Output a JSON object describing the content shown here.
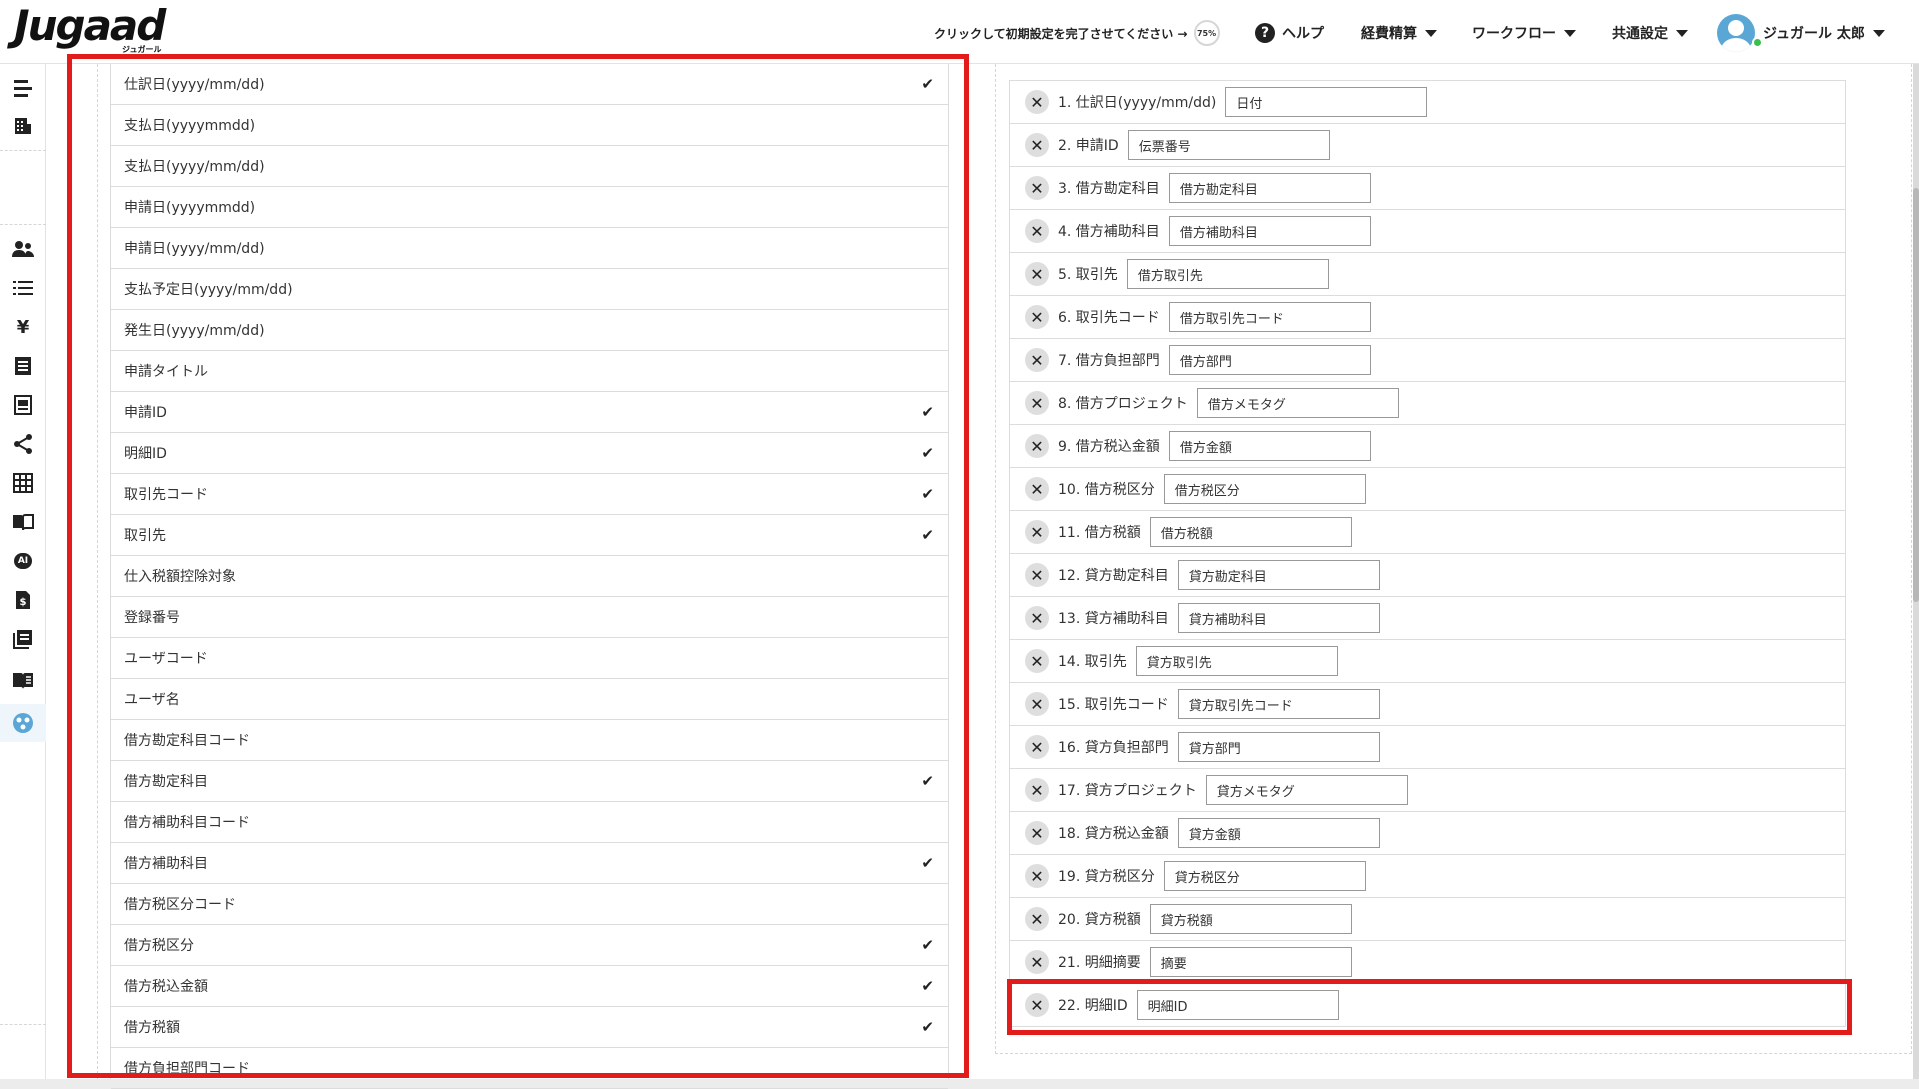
{
  "header": {
    "logo_text": "Jugaad",
    "logo_sub": "ジュガール",
    "setup_text": "クリックして初期設定を完了させてください →",
    "setup_progress": "75%",
    "help_label": "ヘルプ",
    "menus": [
      "経費精算",
      "ワークフロー",
      "共通設定"
    ],
    "user_name": "ジュガール 太郎"
  },
  "left_fields": [
    {
      "label": "仕訳日(yyyy/mm/dd)",
      "checked": true
    },
    {
      "label": "支払日(yyyymmdd)",
      "checked": false
    },
    {
      "label": "支払日(yyyy/mm/dd)",
      "checked": false
    },
    {
      "label": "申請日(yyyymmdd)",
      "checked": false
    },
    {
      "label": "申請日(yyyy/mm/dd)",
      "checked": false
    },
    {
      "label": "支払予定日(yyyy/mm/dd)",
      "checked": false
    },
    {
      "label": "発生日(yyyy/mm/dd)",
      "checked": false
    },
    {
      "label": "申請タイトル",
      "checked": false
    },
    {
      "label": "申請ID",
      "checked": true
    },
    {
      "label": "明細ID",
      "checked": true
    },
    {
      "label": "取引先コード",
      "checked": true
    },
    {
      "label": "取引先",
      "checked": true
    },
    {
      "label": "仕入税額控除対象",
      "checked": false
    },
    {
      "label": "登録番号",
      "checked": false
    },
    {
      "label": "ユーザコード",
      "checked": false
    },
    {
      "label": "ユーザ名",
      "checked": false
    },
    {
      "label": "借方勘定科目コード",
      "checked": false
    },
    {
      "label": "借方勘定科目",
      "checked": true
    },
    {
      "label": "借方補助科目コード",
      "checked": false
    },
    {
      "label": "借方補助科目",
      "checked": true
    },
    {
      "label": "借方税区分コード",
      "checked": false
    },
    {
      "label": "借方税区分",
      "checked": true
    },
    {
      "label": "借方税込金額",
      "checked": true
    },
    {
      "label": "借方税額",
      "checked": true
    },
    {
      "label": "借方負担部門コード",
      "checked": false
    }
  ],
  "check_glyph": "✔",
  "mappings": [
    {
      "label": "1. 仕訳日(yyyy/mm/dd)",
      "value": "日付"
    },
    {
      "label": "2. 申請ID",
      "value": "伝票番号"
    },
    {
      "label": "3. 借方勘定科目",
      "value": "借方勘定科目"
    },
    {
      "label": "4. 借方補助科目",
      "value": "借方補助科目"
    },
    {
      "label": "5. 取引先",
      "value": "借方取引先"
    },
    {
      "label": "6. 取引先コード",
      "value": "借方取引先コード"
    },
    {
      "label": "7. 借方負担部門",
      "value": "借方部門"
    },
    {
      "label": "8. 借方プロジェクト",
      "value": "借方メモタグ"
    },
    {
      "label": "9. 借方税込金額",
      "value": "借方金額"
    },
    {
      "label": "10. 借方税区分",
      "value": "借方税区分"
    },
    {
      "label": "11. 借方税額",
      "value": "借方税額"
    },
    {
      "label": "12. 貸方勘定科目",
      "value": "貸方勘定科目"
    },
    {
      "label": "13. 貸方補助科目",
      "value": "貸方補助科目"
    },
    {
      "label": "14. 取引先",
      "value": "貸方取引先"
    },
    {
      "label": "15. 取引先コード",
      "value": "貸方取引先コード"
    },
    {
      "label": "16. 貸方負担部門",
      "value": "貸方部門"
    },
    {
      "label": "17. 貸方プロジェクト",
      "value": "貸方メモタグ"
    },
    {
      "label": "18. 貸方税込金額",
      "value": "貸方金額"
    },
    {
      "label": "19. 貸方税区分",
      "value": "貸方税区分"
    },
    {
      "label": "20. 貸方税額",
      "value": "貸方税額"
    },
    {
      "label": "21. 明細摘要",
      "value": "摘要"
    },
    {
      "label": "22. 明細ID",
      "value": "明細ID"
    }
  ],
  "remove_glyph": "✕",
  "colors": {
    "highlight": "#e21b1b",
    "accent": "#5aa7d6",
    "online": "#38c149"
  }
}
